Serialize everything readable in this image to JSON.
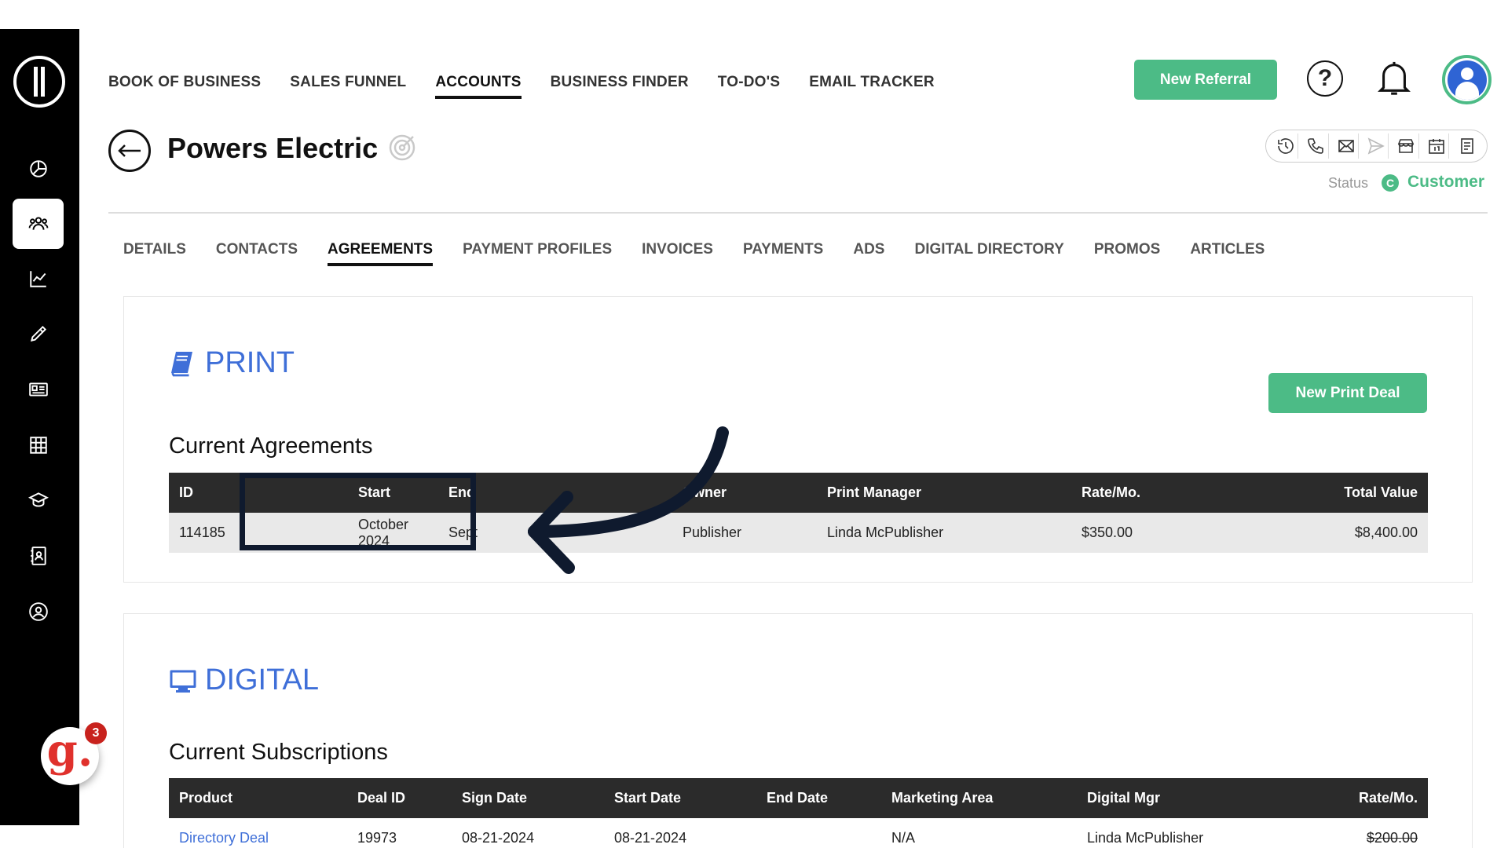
{
  "nav": {
    "items": [
      "BOOK OF BUSINESS",
      "SALES FUNNEL",
      "ACCOUNTS",
      "BUSINESS FINDER",
      "TO-DO'S",
      "EMAIL TRACKER"
    ],
    "active": "ACCOUNTS"
  },
  "header": {
    "new_referral_label": "New Referral",
    "help_symbol": "?"
  },
  "account": {
    "name": "Powers Electric",
    "status_label": "Status",
    "status_badge": "C",
    "status_value": "Customer"
  },
  "tabs": {
    "items": [
      "DETAILS",
      "CONTACTS",
      "AGREEMENTS",
      "PAYMENT PROFILES",
      "INVOICES",
      "PAYMENTS",
      "ADS",
      "DIGITAL DIRECTORY",
      "PROMOS",
      "ARTICLES"
    ],
    "active": "AGREEMENTS"
  },
  "print": {
    "heading": "PRINT",
    "new_deal_label": "New Print Deal",
    "subtitle": "Current Agreements",
    "columns": [
      "ID",
      "Start",
      "End",
      "Owner",
      "Print Manager",
      "Rate/Mo.",
      "Total Value"
    ],
    "rows": [
      [
        "114185",
        "October 2024",
        "Sept",
        "Publisher",
        "Linda McPublisher",
        "$350.00",
        "$8,400.00"
      ]
    ]
  },
  "digital": {
    "heading": "DIGITAL",
    "subtitle": "Current Subscriptions",
    "columns": [
      "Product",
      "Deal ID",
      "Sign Date",
      "Start Date",
      "End Date",
      "Marketing Area",
      "Digital Mgr",
      "Rate/Mo."
    ],
    "rows": [
      [
        "Directory Deal",
        "19973",
        "08-21-2024",
        "08-21-2024",
        "",
        "N/A",
        "Linda McPublisher",
        "$200.00"
      ]
    ]
  },
  "sidebar": {
    "icons": [
      "pie-chart-icon",
      "people-icon",
      "trend-chart-icon",
      "pencil-icon",
      "newspaper-icon",
      "grid-icon",
      "graduation-cap-icon",
      "contact-book-icon",
      "user-circle-icon"
    ],
    "active_index": 1
  },
  "help_widget": {
    "letter": "g.",
    "count": "3"
  },
  "colors": {
    "accent_green": "#4cbb86",
    "accent_blue": "#3f6fd8",
    "sidebar_bg": "#000000",
    "table_header": "#2b2b2b"
  }
}
